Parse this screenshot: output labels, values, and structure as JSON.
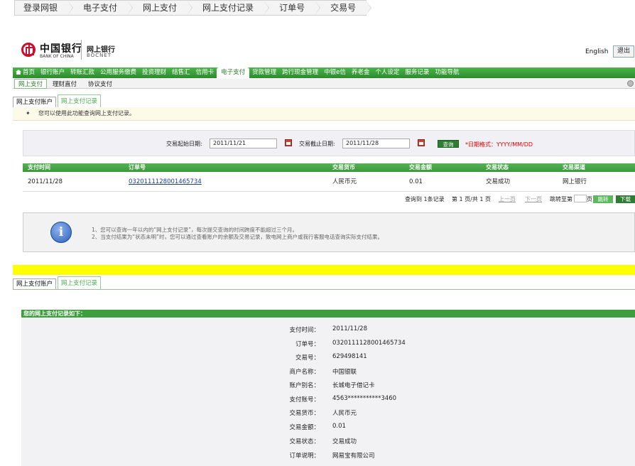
{
  "breadcrumb": [
    "登录网银",
    "电子支付",
    "网上支付",
    "网上支付记录",
    "订单号",
    "交易号"
  ],
  "header": {
    "logo_cn": "中国银行",
    "logo_en": "BANK OF CHINA",
    "brand_cn": "网上银行",
    "brand_en": "BOCNET",
    "english_link": "English",
    "logout_button": "退出"
  },
  "nav": {
    "items": [
      "首页",
      "银行账户",
      "转账汇款",
      "公用服务缴费",
      "投资理财",
      "结售汇",
      "信用卡",
      "电子支付",
      "贷款管理",
      "跨行现金管理",
      "中银e信",
      "养老金",
      "个人设定",
      "服务记录",
      "功能导航"
    ],
    "active": "电子支付"
  },
  "subnav": [
    "网上支付",
    "理财直付",
    "协议支付"
  ],
  "tabs": [
    "网上支付账户",
    "网上支付记录"
  ],
  "tip": "您可以使用此功能查询网上支付记录。",
  "query": {
    "start_label": "交易起始日期:",
    "start_value": "2011/11/21",
    "end_label": "交易截止日期:",
    "end_value": "2011/11/28",
    "button": "查询",
    "hint": "*日期格式：YYYY/MM/DD"
  },
  "table": {
    "columns": [
      "支付时间",
      "订单号",
      "交易货币",
      "交易金额",
      "交易状态",
      "交易渠道"
    ],
    "rows": [
      [
        "2011/11/28",
        "0320111128001465734",
        "人民币元",
        "0.01",
        "交易成功",
        "网上银行"
      ]
    ]
  },
  "pager": {
    "summary": "查询到  1条记录",
    "page": "第  1 页/共  1 页",
    "prev": "上一页",
    "next": "下一页",
    "jump_label": "跳转至第",
    "page_suffix": "页",
    "jump_button": "跳转",
    "download_button": "下载"
  },
  "info": {
    "line1": "1、您可以查询一年以内的“网上支付记录”，每次提交查询的时间跨度不能超过三个月。",
    "line2": "2、当支付结果为“状态未明”时，您可以通过查看账户的余额及交易记录，致电网上商户或我行客服电话查询实际支付结果。"
  },
  "detail": {
    "title": "您的网上支付记录如下：",
    "fields": [
      {
        "label": "支付时间：",
        "value": "2011/11/28"
      },
      {
        "label": "订单号：",
        "value": "0320111128001465734"
      },
      {
        "label": "交易号：",
        "value": "629498141"
      },
      {
        "label": "商户名称：",
        "value": "中国银联"
      },
      {
        "label": "账户别名：",
        "value": "长城电子借记卡"
      },
      {
        "label": "支付账号：",
        "value": "4563***********3460"
      },
      {
        "label": "交易货币：",
        "value": "人民币元"
      },
      {
        "label": "交易金额：",
        "value": "0.01"
      },
      {
        "label": "交易状态：",
        "value": "交易成功"
      },
      {
        "label": "订单说明：",
        "value": "网易宝有限公司"
      }
    ]
  }
}
